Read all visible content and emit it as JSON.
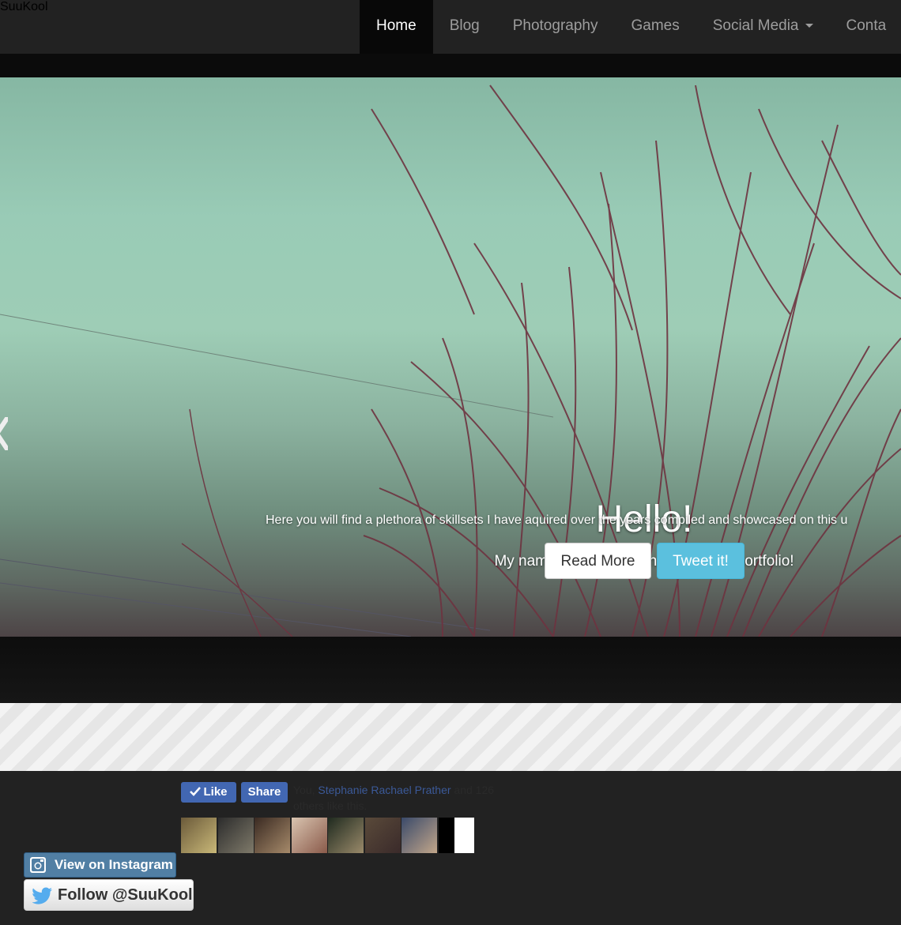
{
  "logo": {
    "text": "SuuKool"
  },
  "nav": {
    "items": [
      {
        "label": "Home"
      },
      {
        "label": "Blog"
      },
      {
        "label": "Photography"
      },
      {
        "label": "Games"
      },
      {
        "label": "Social Media"
      },
      {
        "label": "Conta"
      }
    ]
  },
  "hero": {
    "title": "Hello!",
    "subtitle": "My name is SuuKool, and this is my portfolio!",
    "description": "Here you will find a plethora of skillsets I have aquired over the years compiled and showcased on this u",
    "read_more_label": "Read More",
    "tweet_label": "Tweet it!"
  },
  "facebook": {
    "like_label": "Like",
    "share_label": "Share",
    "likes_prefix": "You, ",
    "likes_name": "Stephanie Rachael Prather",
    "likes_suffix": " and 126 others like this."
  },
  "instagram": {
    "label": "View on Instagram"
  },
  "twitter": {
    "label": "Follow @SuuKool"
  },
  "colors": {
    "navbar": "#222222",
    "active_nav": "#080808",
    "tweet_button": "#5bc0de",
    "facebook_button": "#4267b2",
    "instagram_button": "#517fa4"
  }
}
